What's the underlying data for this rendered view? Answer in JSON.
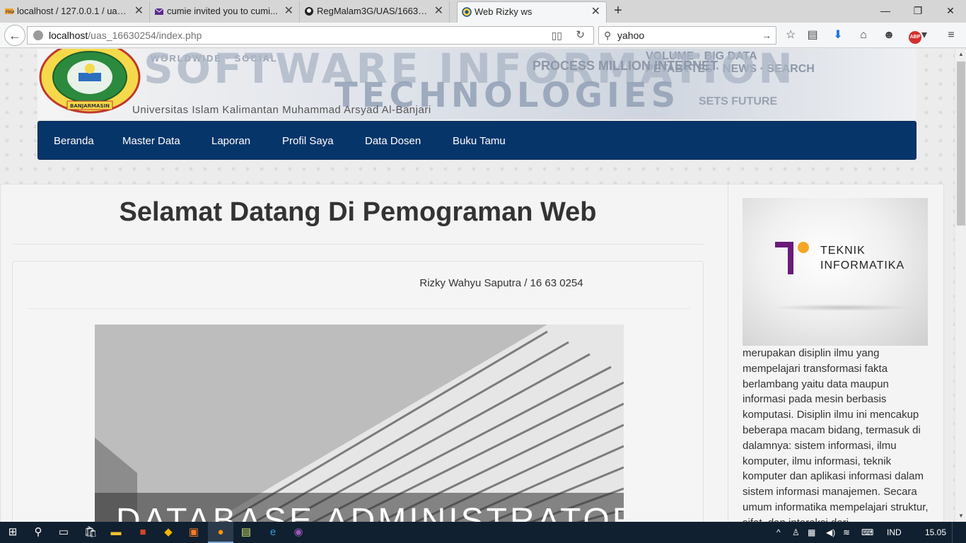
{
  "browser": {
    "tabs": [
      {
        "title": "localhost / 127.0.0.1 / uas_...",
        "active": false,
        "favicon": "phpmyadmin-icon"
      },
      {
        "title": "cumie invited you to cumi...",
        "active": false,
        "favicon": "mail-icon"
      },
      {
        "title": "RegMalam3G/UAS/166303...",
        "active": false,
        "favicon": "github-icon"
      },
      {
        "title": "Web Rizky ws",
        "active": true,
        "favicon": "site-icon"
      }
    ],
    "url_host": "localhost",
    "url_path": "/uas_16630254/index.php",
    "search_value": "yahoo"
  },
  "site": {
    "university_name": "Universitas Islam Kalimantan Muhammad Arsyad Al-Banjari",
    "logo_caption": "BANJARMASIN",
    "banner_words": [
      "SOFTWARE",
      "INFORMATION",
      "TECHNOLOGIES",
      "BIG DATA",
      "INTERNET",
      "PETABYTES",
      "MILLION",
      "PROCESS",
      "SOCIAL",
      "WORLDWIDE",
      "VOLUME",
      "SEARCH",
      "NEWS",
      "SETS",
      "FUTURE"
    ],
    "nav": [
      "Beranda",
      "Master Data",
      "Laporan",
      "Profil Saya",
      "Data Dosen",
      "Buku Tamu"
    ],
    "page_title": "Selamat Datang Di Pemograman Web",
    "author": "Rizky Wahyu Saputra / 16 63 0254",
    "hero_text": "DATABASE ADMINISTRATOR",
    "sidebar": {
      "logo_line1": "TEKNIK",
      "logo_line2": "INFORMATIKA",
      "text": "merupakan disiplin ilmu yang mempelajari transformasi fakta berlambang yaitu data maupun informasi pada mesin berbasis komputasi. Disiplin ilmu ini mencakup beberapa macam bidang, termasuk di dalamnya: sistem informasi, ilmu komputer, ilmu informasi, teknik komputer dan aplikasi informasi dalam sistem informasi manajemen. Secara umum informatika mempelajari struktur, sifat, dan interaksi dari"
    }
  },
  "taskbar": {
    "language": "IND",
    "time": "15.05"
  },
  "colors": {
    "nav_bg": "#06356a",
    "taskbar_bg": "#102030"
  }
}
